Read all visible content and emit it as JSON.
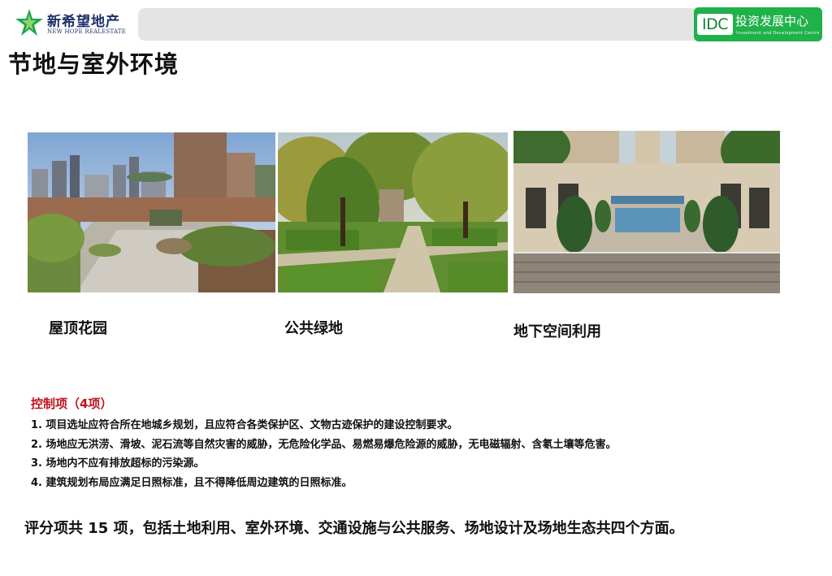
{
  "header": {
    "logo_name": "新希望地产",
    "logo_sub": "NEW HOPE REALESTATE",
    "idc_label": "IDC",
    "idc_title": "投资发展中心",
    "idc_sub": "Investment and Development Centre",
    "brand_color": "#1fb14a"
  },
  "page_title": "节地与室外环境",
  "photos": [
    {
      "caption": "屋顶花园"
    },
    {
      "caption": "公共绿地"
    },
    {
      "caption": "地下空间利用"
    }
  ],
  "control": {
    "heading": "控制项（4项）",
    "heading_color": "#c0141e",
    "items": [
      "1.  项目选址应符合所在地城乡规划，且应符合各类保护区、文物古迹保护的建设控制要求。",
      "2.  场地应无洪涝、滑坡、泥石流等自然灾害的威胁，无危险化学品、易燃易爆危险源的威胁，无电磁辐射、含氡土壤等危害。",
      "3.  场地内不应有排放超标的污染源。",
      "4.  建筑规划布局应满足日照标准，且不得降低周边建筑的日照标准。"
    ]
  },
  "score_summary": "评分项共 15 项，包括土地利用、室外环境、交通设施与公共服务、场地设计及场地生态共四个方面。"
}
